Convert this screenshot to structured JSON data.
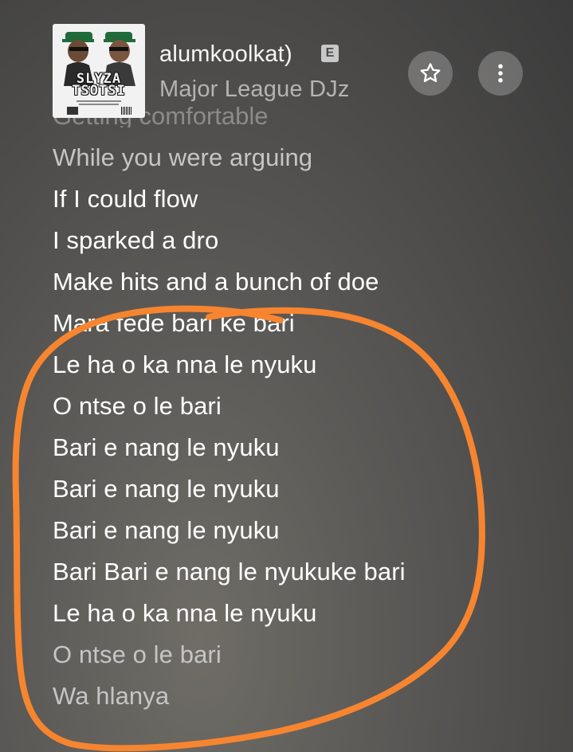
{
  "header": {
    "song_title": "alumkoolkat)",
    "explicit_badge": "E",
    "artist": "Major League DJz",
    "artwork_text": "SLYZA TSOTSI"
  },
  "icons": {
    "favorite": "star-icon",
    "more": "more-vertical-icon"
  },
  "lyrics": {
    "partial_line": "Getting comfortable",
    "lines": [
      "While you were arguing",
      "If I could flow",
      "I sparked a dro",
      "Make hits and a bunch of doe",
      "Mara fede bari ke bari",
      "Le ha o ka nna le nyuku",
      "O ntse o le bari",
      "Bari e nang le nyuku",
      "Bari e nang le nyuku",
      "Bari e nang le nyuku",
      "Bari Bari e nang le nyukuke bari",
      "Le ha o ka nna le nyuku",
      "O ntse o le bari",
      "Wa hlanya"
    ]
  },
  "colors": {
    "annotation_circle": "#f7852f",
    "background": "#4a4948"
  }
}
